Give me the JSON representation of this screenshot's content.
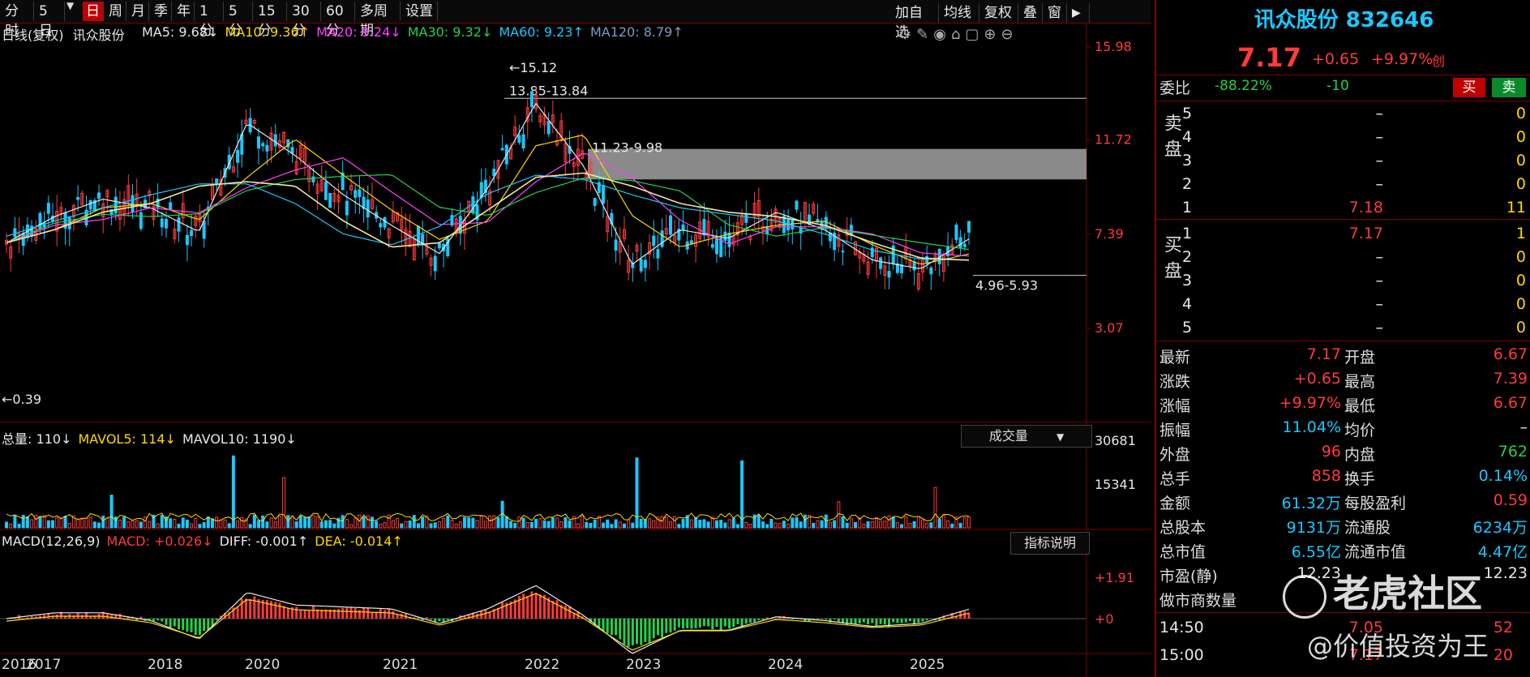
{
  "toolbar": {
    "items": [
      "分时",
      "5日",
      "日",
      "周",
      "月",
      "季",
      "年",
      "1分",
      "5分",
      "15分",
      "30分",
      "60分",
      "多周期",
      "设置"
    ],
    "active": "日",
    "right_items": [
      "加自选",
      "均线",
      "复权",
      "叠",
      "窗"
    ]
  },
  "ma_legend": {
    "period": "日线(复权)",
    "name": "讯众股份",
    "items": [
      {
        "text": "MA5: 9.68↓",
        "color": "#e8e8e8"
      },
      {
        "text": "MA10: 9.36↑",
        "color": "#ffd700"
      },
      {
        "text": "MA20: 9.24↓",
        "color": "#ff40ff"
      },
      {
        "text": "MA30: 9.32↓",
        "color": "#26d04a"
      },
      {
        "text": "MA60: 9.23↑",
        "color": "#19c8ff"
      },
      {
        "text": "MA120: 8.79↑",
        "color": "#7a9cc6"
      }
    ]
  },
  "chart_data": [
    {
      "type": "line",
      "title": "日线(复权) 讯众股份",
      "x": [
        "2016",
        "2017",
        "2018",
        "2020",
        "2021",
        "2022",
        "2023",
        "2024",
        "2025"
      ],
      "x_positions": [
        0,
        0.03,
        0.14,
        0.23,
        0.34,
        0.47,
        0.56,
        0.68,
        0.8
      ],
      "yticks": [
        3.07,
        7.39,
        11.72,
        15.98
      ],
      "ylim": [
        -0.39,
        15.98
      ],
      "annotations": [
        "15.12",
        "13.85-13.84",
        "11.23-9.98",
        "4.96-5.93",
        "0.39"
      ],
      "series": [
        {
          "name": "MA5",
          "values": [
            7.0,
            8.2,
            9.0,
            8.6,
            7.5,
            12.5,
            11.0,
            9.2,
            7.8,
            6.5,
            9.5,
            13.4,
            10.5,
            6.0,
            7.6,
            7.2,
            8.4,
            7.6,
            6.2,
            5.8,
            7.17
          ]
        },
        {
          "name": "MA120",
          "values": [
            7.0,
            7.6,
            8.4,
            8.8,
            9.6,
            9.8,
            9.6,
            8.0,
            6.8,
            7.0,
            8.5,
            10.0,
            10.2,
            9.6,
            8.8,
            8.4,
            8.2,
            7.8,
            7.0,
            6.3,
            6.2
          ]
        }
      ]
    },
    {
      "type": "bar",
      "title": "成交量",
      "legend": [
        "总量: 110↓",
        "MAVOL5: 114↓",
        "MAVOL10: 1190↓"
      ],
      "yticks": [
        15341,
        30681
      ]
    },
    {
      "type": "bar",
      "title": "MACD(12,26,9)",
      "legend": [
        "MACD: +0.026↓",
        "DIFF: -0.001↑",
        "DEA: -0.014↑"
      ],
      "yticks": [
        "+0",
        "+1.91"
      ]
    }
  ],
  "vol_panel": {
    "dropdown": "成交量"
  },
  "macd_panel": {
    "button": "指标说明"
  },
  "x_axis_labels": [
    "2016",
    "2017",
    "2018",
    "2020",
    "2021",
    "2022",
    "2023",
    "2024",
    "2025"
  ],
  "panel": {
    "title": "讯众股份 832646",
    "price": "7.17",
    "change": "+0.65",
    "pct": "+9.97%",
    "tag": "创",
    "wb_label": "委比",
    "wb_pct": "-88.22%",
    "wb_diff": "-10",
    "buy_btn": "买",
    "sell_btn": "卖",
    "sell_label": "卖盘",
    "buy_label": "买盘",
    "sells": [
      {
        "n": "5",
        "price": "–",
        "vol": "0"
      },
      {
        "n": "4",
        "price": "–",
        "vol": "0"
      },
      {
        "n": "3",
        "price": "–",
        "vol": "0"
      },
      {
        "n": "2",
        "price": "–",
        "vol": "0"
      },
      {
        "n": "1",
        "price": "7.18",
        "vol": "11"
      }
    ],
    "buys": [
      {
        "n": "1",
        "price": "7.17",
        "vol": "1"
      },
      {
        "n": "2",
        "price": "–",
        "vol": "0"
      },
      {
        "n": "3",
        "price": "–",
        "vol": "0"
      },
      {
        "n": "4",
        "price": "–",
        "vol": "0"
      },
      {
        "n": "5",
        "price": "–",
        "vol": "0"
      }
    ],
    "stats": [
      {
        "l1": "最新",
        "v1": "7.17",
        "c1": "#ff3b3b",
        "l2": "开盘",
        "v2": "6.67",
        "c2": "#ff3b3b"
      },
      {
        "l1": "涨跌",
        "v1": "+0.65",
        "c1": "#ff3b3b",
        "l2": "最高",
        "v2": "7.39",
        "c2": "#ff3b3b"
      },
      {
        "l1": "涨幅",
        "v1": "+9.97%",
        "c1": "#ff3b3b",
        "l2": "最低",
        "v2": "6.67",
        "c2": "#ff3b3b"
      },
      {
        "l1": "振幅",
        "v1": "11.04%",
        "c1": "#19c8ff",
        "l2": "均价",
        "v2": "–",
        "c2": "#e8e8e8"
      },
      {
        "l1": "外盘",
        "v1": "96",
        "c1": "#ff3b3b",
        "l2": "内盘",
        "v2": "762",
        "c2": "#26d04a"
      },
      {
        "l1": "总手",
        "v1": "858",
        "c1": "#ff3b3b",
        "l2": "换手",
        "v2": "0.14%",
        "c2": "#19c8ff"
      },
      {
        "l1": "金额",
        "v1": "61.32万",
        "c1": "#19c8ff",
        "l2": "每股盈利",
        "v2": "0.59",
        "c2": "#ff3b3b"
      },
      {
        "l1": "总股本",
        "v1": "9131万",
        "c1": "#19c8ff",
        "l2": "流通股",
        "v2": "6234万",
        "c2": "#19c8ff"
      },
      {
        "l1": "总市值",
        "v1": "6.55亿",
        "c1": "#19c8ff",
        "l2": "流通市值",
        "v2": "4.47亿",
        "c2": "#19c8ff"
      },
      {
        "l1": "市盈(静)",
        "v1": "12.23",
        "c1": "#e8e8e8",
        "l2": "",
        "v2": "12.23",
        "c2": "#e8e8e8"
      },
      {
        "l1": "做市商数量",
        "v1": "–",
        "c1": "#e8e8e8",
        "l2": "",
        "v2": "",
        "c2": "#e8e8e8"
      }
    ],
    "ticks": [
      {
        "time": "14:50",
        "price": "7.05",
        "vol": "52"
      },
      {
        "time": "15:00",
        "price": "7.17",
        "vol": "20"
      }
    ]
  },
  "watermark": {
    "brand": "老虎社区",
    "handle": "@价值投资为王"
  },
  "colors": {
    "up": "#ff3b3b",
    "down": "#26d04a",
    "grid": "#7a0000",
    "ma5": "#e8e8e8",
    "ma10": "#ffd700",
    "ma20": "#ff40ff",
    "ma30": "#26d04a",
    "ma60": "#19c8ff",
    "ma120": "#7a9cc6"
  }
}
